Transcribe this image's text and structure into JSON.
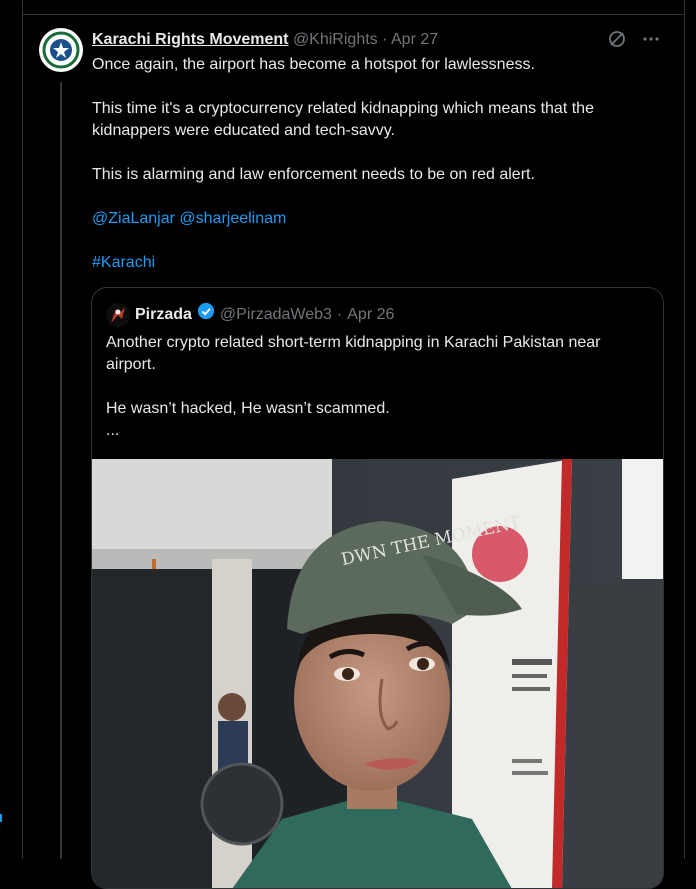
{
  "tweet": {
    "author_name": "Karachi Rights Movement",
    "handle": "@KhiRights",
    "separator": "·",
    "date": "Apr 27",
    "avatar_icon": "karachi-rights-logo-icon",
    "lines": [
      "Once again, the airport has become a hotspot for lawlessness.",
      "This time it's a cryptocurrency related kidnapping which means that the kidnappers were educated and tech-savvy.",
      "This is alarming and law enforcement needs to be on red alert."
    ],
    "mentions": [
      "@ZiaLanjar",
      "@sharjeelinam"
    ],
    "hashtag": "#Karachi",
    "icons": [
      "grok-icon",
      "more-icon"
    ]
  },
  "quoted": {
    "author_name": "Pirzada",
    "handle": "@PirzadaWeb3",
    "separator": "·",
    "date": "Apr 26",
    "verified_icon": "verified-badge-icon",
    "lines": [
      "Another crypto related short-term kidnapping in Karachi Pakistan near airport.",
      "He wasn’t hacked, He wasn’t scammed.",
      "..."
    ],
    "media_description_icon": "video-thumbnail-image",
    "cap_text": "DWN THE MOMENT"
  },
  "colors": {
    "background": "#000000",
    "text": "#e7e9ea",
    "muted": "#71767b",
    "link": "#1d9bf0",
    "border": "#2f3336"
  }
}
